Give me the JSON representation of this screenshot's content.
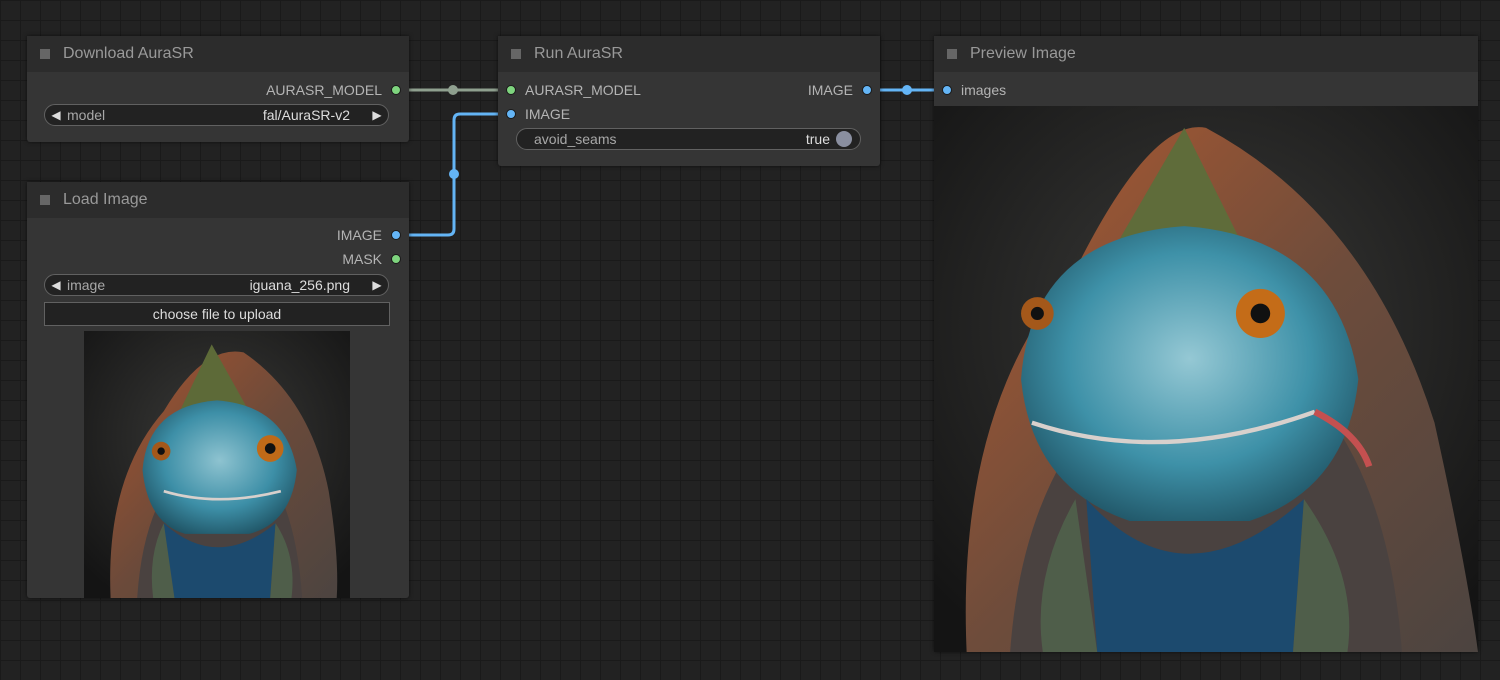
{
  "nodes": {
    "download_aurasr": {
      "title": "Download AuraSR",
      "outputs": [
        "AURASR_MODEL"
      ],
      "widget": {
        "label": "model",
        "value": "fal/AuraSR-v2"
      }
    },
    "load_image": {
      "title": "Load Image",
      "outputs": [
        "IMAGE",
        "MASK"
      ],
      "widget": {
        "label": "image",
        "value": "iguana_256.png"
      },
      "upload_button": "choose file to upload"
    },
    "run_aurasr": {
      "title": "Run AuraSR",
      "inputs": [
        "AURASR_MODEL",
        "IMAGE"
      ],
      "outputs": [
        "IMAGE"
      ],
      "toggle": {
        "label": "avoid_seams",
        "value": "true"
      }
    },
    "preview_image": {
      "title": "Preview Image",
      "inputs": [
        "images"
      ]
    }
  },
  "colors": {
    "model_link": "#8fa08f",
    "image_link": "#64b5f6",
    "model_slot": "#7ed47e",
    "image_slot": "#64b5f6"
  },
  "icons": {
    "arrow_left": "◀",
    "arrow_right": "▶"
  }
}
